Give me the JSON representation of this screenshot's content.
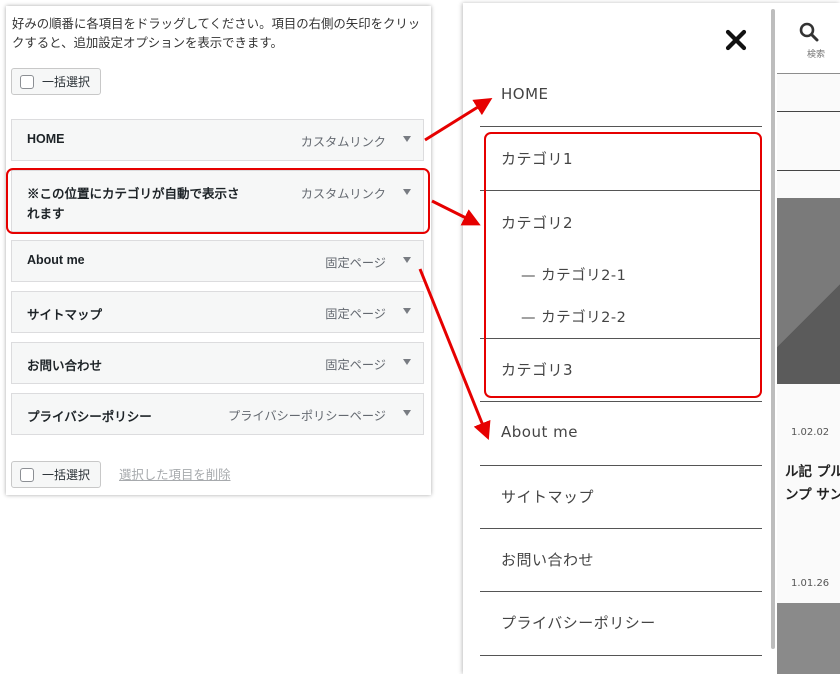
{
  "editor": {
    "instruction": "好みの順番に各項目をドラッグしてください。項目の右側の矢印をクリックすると、追加設定オプションを表示できます。",
    "bulk_select_label": "一括選択",
    "delete_selected_label": "選択した項目を削除",
    "items": [
      {
        "title": "HOME",
        "type": "カスタムリンク"
      },
      {
        "title": "※この位置にカテゴリが自動で表示されます",
        "type": "カスタムリンク"
      },
      {
        "title": "About me",
        "type": "固定ページ"
      },
      {
        "title": "サイトマップ",
        "type": "固定ページ"
      },
      {
        "title": "お問い合わせ",
        "type": "固定ページ"
      },
      {
        "title": "プライバシーポリシー",
        "type": "プライバシーポリシーページ"
      }
    ]
  },
  "preview": {
    "close_icon": "close-x-icon",
    "search_label": "検索",
    "nav": [
      {
        "label": "HOME"
      },
      {
        "label": "カテゴリ1"
      },
      {
        "label": "カテゴリ2"
      },
      {
        "label": "— カテゴリ2-1"
      },
      {
        "label": "— カテゴリ2-2"
      },
      {
        "label": "カテゴリ3"
      },
      {
        "label": "About me"
      },
      {
        "label": "サイトマップ"
      },
      {
        "label": "お問い合わせ"
      },
      {
        "label": "プライバシーポリシー"
      }
    ],
    "backdrop": {
      "date1": "1.02.02",
      "title_fragment": "ル記 プル ンプ サン",
      "date2": "1.01.26"
    }
  },
  "colors": {
    "highlight": "#e60000",
    "drawer_text": "#444444",
    "backdrop": "#8d8d8d"
  }
}
